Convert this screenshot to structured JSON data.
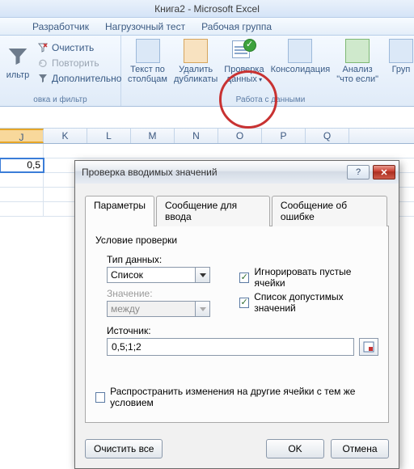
{
  "title": "Книга2 - Microsoft Excel",
  "ribbon_tabs": {
    "developer": "Разработчик",
    "loadtest": "Нагрузочный тест",
    "team": "Рабочая группа"
  },
  "sortfilter": {
    "clear": "Очистить",
    "reapply": "Повторить",
    "advanced": "Дополнительно",
    "filter_lbl": "ильтр",
    "group_label": "овка и фильтр"
  },
  "datatools": {
    "text_to_columns": "Текст по\nстолбцам",
    "remove_dupes": "Удалить\nдубликаты",
    "data_validation": "Проверка\nданных",
    "consolidate": "Консолидация",
    "whatif": "Анализ\n\"что если\"",
    "group_lbl": "Груп",
    "group_label": "Работа с данными"
  },
  "grid": {
    "columns": [
      "J",
      "K",
      "L",
      "M",
      "N",
      "O",
      "P",
      "Q"
    ],
    "active_cell_value": "0,5"
  },
  "dialog": {
    "title": "Проверка вводимых значений",
    "help": "?",
    "close": "✕",
    "tabs": {
      "params": "Параметры",
      "input_msg": "Сообщение для ввода",
      "error_msg": "Сообщение об ошибке"
    },
    "section": "Условие проверки",
    "fields": {
      "type_label": "Тип данных:",
      "type_value": "Список",
      "value_label": "Значение:",
      "value_value": "между",
      "source_label": "Источник:",
      "source_value": "0,5;1;2",
      "ignore_blank": "Игнорировать пустые ячейки",
      "in_cell_dropdown": "Список допустимых значений",
      "propagate": "Распространить изменения на другие ячейки с тем же условием"
    },
    "buttons": {
      "clear_all": "Очистить все",
      "ok": "OK",
      "cancel": "Отмена"
    }
  }
}
